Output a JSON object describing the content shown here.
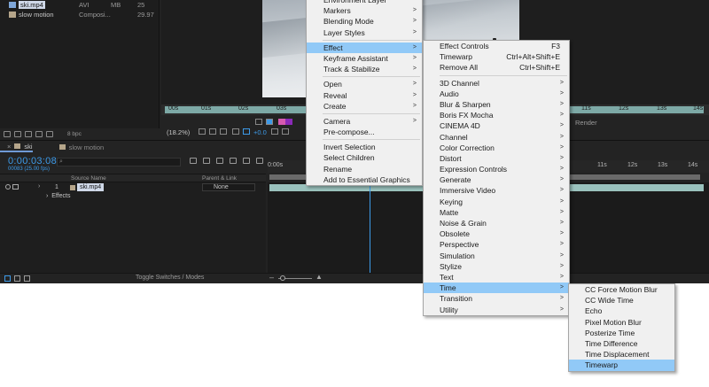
{
  "project": {
    "rows": [
      {
        "name": "ski.mp4",
        "type": "AVI",
        "size": "MB",
        "frame_rate": "25",
        "selected": true
      },
      {
        "name": "slow motion",
        "type": "Composi...",
        "size": "",
        "frame_rate": "29.97",
        "selected": false
      }
    ],
    "bpc": "8 bpc"
  },
  "viewer": {
    "ruler_ticks": [
      "00s",
      "01s",
      "02s",
      "03s",
      "11s",
      "12s",
      "13s",
      "14s"
    ],
    "zoom": "(18.2%)",
    "exposure": "+0.0",
    "render_label": "Render"
  },
  "timeline": {
    "tabs": [
      "ski",
      "slow motion"
    ],
    "timecode": "0:00:03:08",
    "frames_fps": "00083 (25.00 fps)",
    "search_placeholder": "⌕",
    "header": {
      "source_name": "Source Name",
      "parent_link": "Parent & Link"
    },
    "layer": {
      "number": "1",
      "name": "ski.mp4",
      "parent": "None"
    },
    "effects_label": "Effects",
    "ruler_ticks": [
      "0:00s",
      "11s",
      "12s",
      "13s",
      "14s"
    ],
    "toggle_label": "Toggle Switches / Modes"
  },
  "menus": {
    "main": {
      "items": [
        {
          "label": "Environment Layer",
          "arrow": false
        },
        {
          "label": "Markers",
          "arrow": true
        },
        {
          "label": "Blending Mode",
          "arrow": true
        },
        {
          "label": "Layer Styles",
          "arrow": true
        },
        {
          "sep": true
        },
        {
          "label": "Effect",
          "arrow": true,
          "highlight": true
        },
        {
          "label": "Keyframe Assistant",
          "arrow": true
        },
        {
          "label": "Track & Stabilize",
          "arrow": true
        },
        {
          "sep": true
        },
        {
          "label": "Open",
          "arrow": true
        },
        {
          "label": "Reveal",
          "arrow": true
        },
        {
          "label": "Create",
          "arrow": true
        },
        {
          "sep": true
        },
        {
          "label": "Camera",
          "arrow": true
        },
        {
          "label": "Pre-compose...",
          "arrow": false
        },
        {
          "sep": true
        },
        {
          "label": "Invert Selection",
          "arrow": false
        },
        {
          "label": "Select Children",
          "arrow": false
        },
        {
          "label": "Rename",
          "arrow": false
        },
        {
          "label": "Add to Essential Graphics",
          "arrow": false
        }
      ]
    },
    "effect": {
      "items": [
        {
          "label": "Effect Controls",
          "shortcut": "F3"
        },
        {
          "label": "Timewarp",
          "shortcut": "Ctrl+Alt+Shift+E"
        },
        {
          "label": "Remove All",
          "shortcut": "Ctrl+Shift+E"
        },
        {
          "sep": true
        },
        {
          "label": "3D Channel",
          "arrow": true
        },
        {
          "label": "Audio",
          "arrow": true
        },
        {
          "label": "Blur & Sharpen",
          "arrow": true
        },
        {
          "label": "Boris FX Mocha",
          "arrow": true
        },
        {
          "label": "CINEMA 4D",
          "arrow": true
        },
        {
          "label": "Channel",
          "arrow": true
        },
        {
          "label": "Color Correction",
          "arrow": true
        },
        {
          "label": "Distort",
          "arrow": true
        },
        {
          "label": "Expression Controls",
          "arrow": true
        },
        {
          "label": "Generate",
          "arrow": true
        },
        {
          "label": "Immersive Video",
          "arrow": true
        },
        {
          "label": "Keying",
          "arrow": true
        },
        {
          "label": "Matte",
          "arrow": true
        },
        {
          "label": "Noise & Grain",
          "arrow": true
        },
        {
          "label": "Obsolete",
          "arrow": true
        },
        {
          "label": "Perspective",
          "arrow": true
        },
        {
          "label": "Simulation",
          "arrow": true
        },
        {
          "label": "Stylize",
          "arrow": true
        },
        {
          "label": "Text",
          "arrow": true
        },
        {
          "label": "Time",
          "arrow": true,
          "highlight": true
        },
        {
          "label": "Transition",
          "arrow": true
        },
        {
          "label": "Utility",
          "arrow": true
        }
      ]
    },
    "time": {
      "items": [
        {
          "label": "CC Force Motion Blur"
        },
        {
          "label": "CC Wide Time"
        },
        {
          "label": "Echo"
        },
        {
          "label": "Pixel Motion Blur"
        },
        {
          "label": "Posterize Time"
        },
        {
          "label": "Time Difference"
        },
        {
          "label": "Time Displacement"
        },
        {
          "label": "Timewarp",
          "highlight": true
        }
      ]
    }
  },
  "colors": {
    "accent_blue": "#3d9ae8",
    "menu_highlight": "#91c9f7",
    "layer_bar": "#9ac2bd"
  }
}
